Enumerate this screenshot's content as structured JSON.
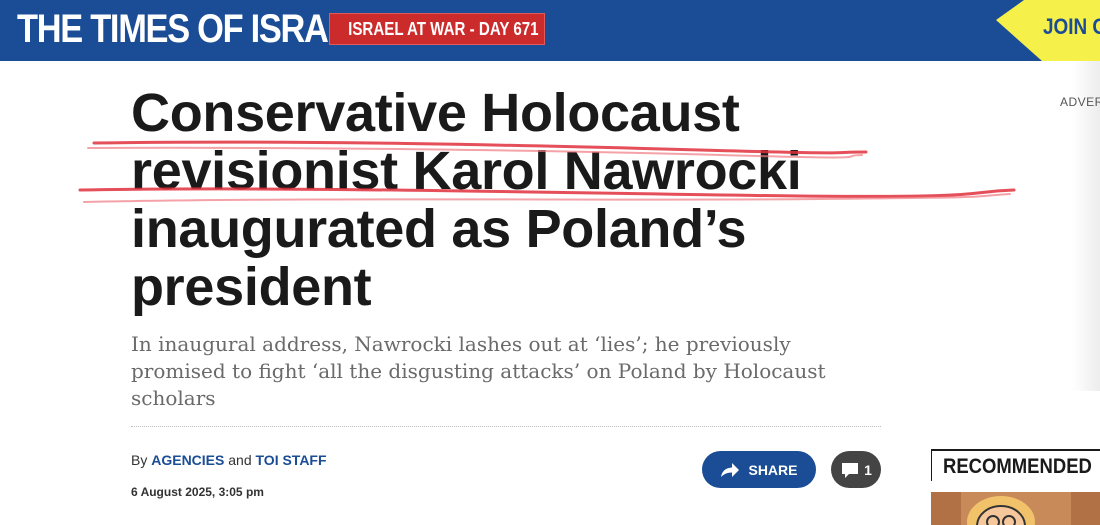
{
  "header": {
    "logo": "THE TIMES OF ISRAEL",
    "war_badge": "ISRAEL AT WAR - DAY 671",
    "join_label": "JOIN O"
  },
  "sidebar": {
    "advert_label": "ADVER",
    "recommended_label": "RECOMMENDED"
  },
  "article": {
    "headline": "Conservative Holocaust revisionist Karol Nawrocki inaugurated as Poland’s president",
    "subhead": "In inaugural address, Nawrocki lashes out at ‘lies’; he previously promised to fight ‘all the disgusting attacks’ on Poland by Holocaust scholars",
    "byline_prefix": "By",
    "author1": "AGENCIES",
    "byline_and": "and",
    "author2": "TOI STAFF",
    "date": "6 August 2025, 3:05 pm"
  },
  "actions": {
    "share_label": "SHARE",
    "comment_count": "1"
  },
  "colors": {
    "brand_blue": "#1a4d96",
    "war_red": "#cc2b2b",
    "join_yellow": "#f5f04a",
    "annotation_red": "#e0303c"
  },
  "icons": [
    "share-arrow-icon",
    "comment-bubble-icon"
  ]
}
